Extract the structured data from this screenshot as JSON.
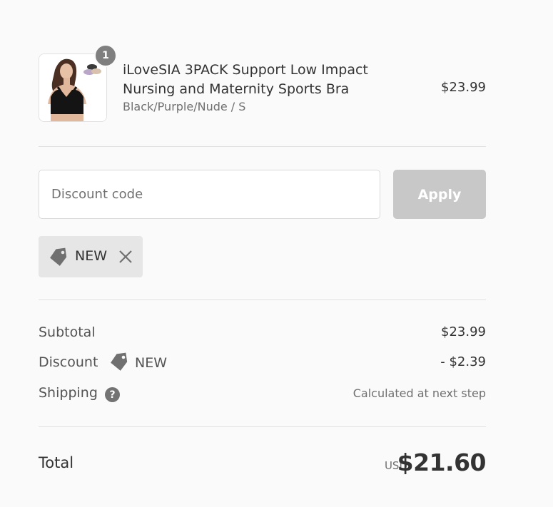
{
  "product": {
    "name": "iLoveSIA 3PACK Support Low Impact Nursing and Maternity Sports Bra",
    "variant": "Black/Purple/Nude / S",
    "price": "$23.99",
    "quantity": "1",
    "image_icon": "product-photo-sports-bra"
  },
  "discount": {
    "placeholder": "Discount code",
    "apply_label": "Apply",
    "applied_code": "NEW",
    "tag_icon": "tag-icon",
    "remove_icon": "close-icon"
  },
  "summary": {
    "subtotal_label": "Subtotal",
    "subtotal_value": "$23.99",
    "discount_label": "Discount",
    "discount_code": "NEW",
    "discount_value": "- $2.39",
    "shipping_label": "Shipping",
    "shipping_help": "?",
    "shipping_value": "Calculated at next step"
  },
  "total": {
    "label": "Total",
    "currency": "USD",
    "amount": "$21.60"
  },
  "colors": {
    "background": "#fafafa",
    "apply_disabled": "#c8c8c8",
    "chip": "#e6e6e6",
    "badge": "#7f7f7f"
  }
}
